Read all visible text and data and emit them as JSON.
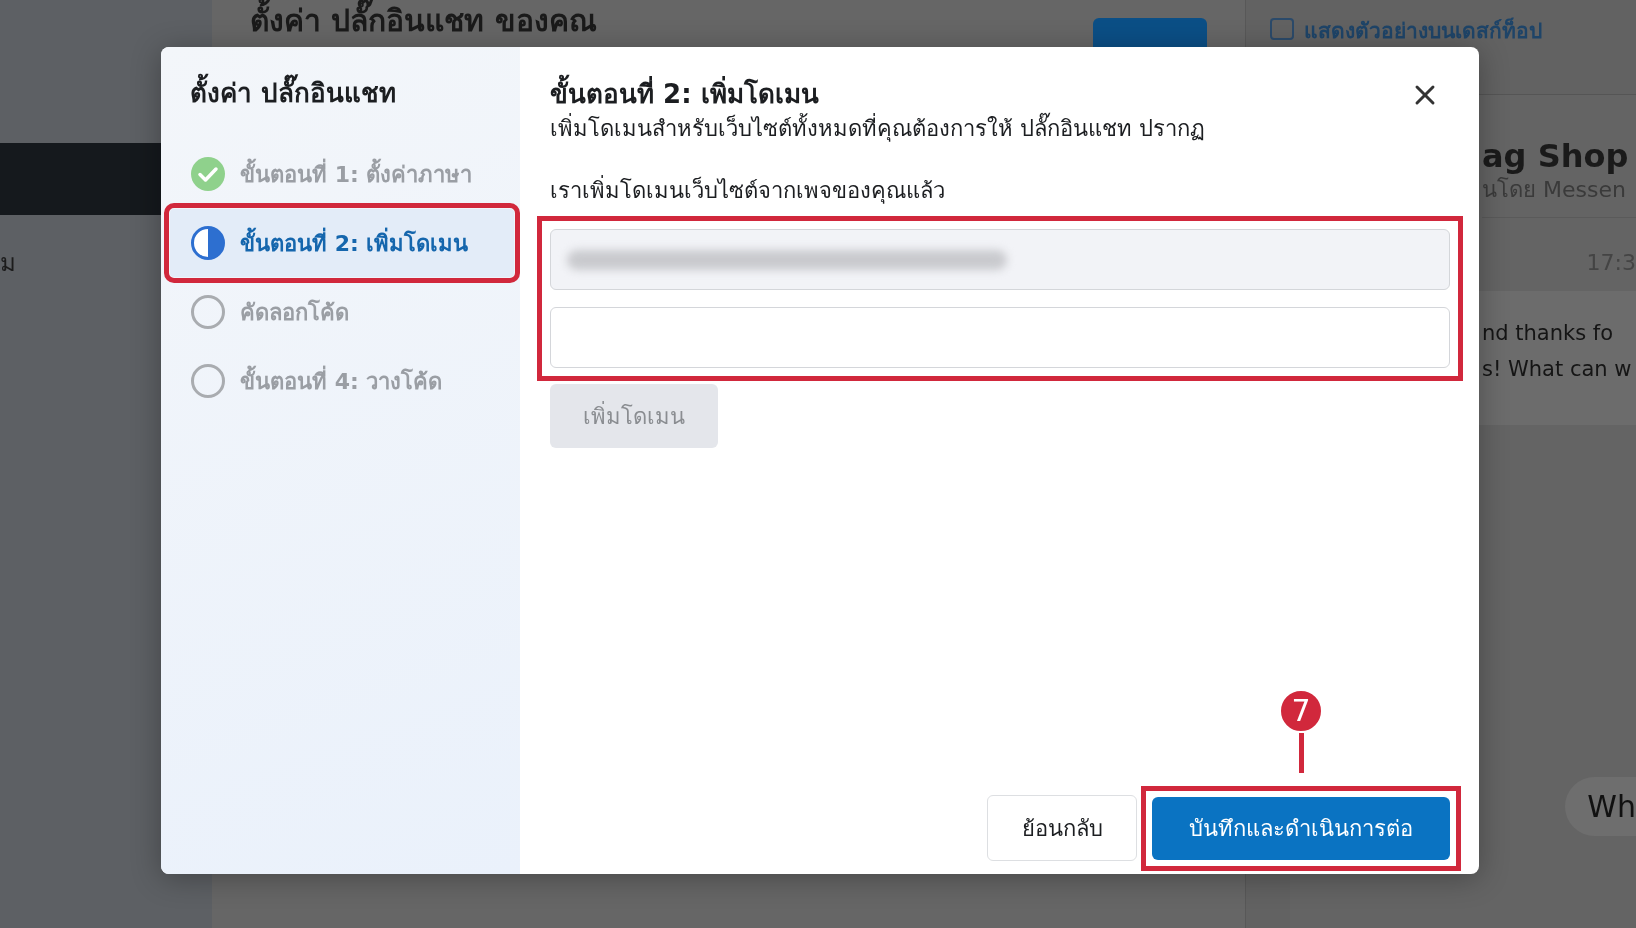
{
  "background": {
    "page_title": "ตั้งค่า ปลั๊กอินแชท ของคณ",
    "sidebar_text": "ม",
    "preview_checkbox": {
      "label": "แสดงตัวอย่างบนเดสก์ท็อป",
      "checked": false
    },
    "preview": {
      "shop_name": "ag Shop",
      "subtitle": "นโดย Messen",
      "time": "17:3",
      "message_lines": [
        "nd thanks fo",
        "s! What can w"
      ],
      "reply": "Wh"
    }
  },
  "dialog": {
    "sidebar_title": "ตั้งค่า ปลั๊กอินแชท",
    "steps": [
      {
        "label": "ขั้นตอนที่ 1: ตั้งค่าภาษา",
        "kind": "done",
        "selected": false,
        "highlighted": false
      },
      {
        "label": "ขั้นตอนที่ 2: เพิ่มโดเมน",
        "kind": "current",
        "selected": true,
        "highlighted": true
      },
      {
        "label": "คัดลอกโค้ด",
        "kind": "pending",
        "selected": false,
        "highlighted": false
      },
      {
        "label": "ขั้นตอนที่ 4: วางโค้ด",
        "kind": "pending",
        "selected": false,
        "highlighted": false
      }
    ],
    "title": "ขั้นตอนที่ 2: เพิ่มโดเมน",
    "description": "เพิ่มโดเมนสำหรับเว็บไซต์ทั้งหมดที่คุณต้องการให้ ปลั๊กอินแชท ปรากฏ",
    "domains_label": "เราเพิ่มโดเมนเว็บไซต์จากเพจของคุณแล้ว",
    "domains_highlighted": true,
    "domain_fields": [
      {
        "kind": "redacted"
      },
      {
        "kind": "empty"
      }
    ],
    "add_button": {
      "label": "เพิ่มโดเมน",
      "disabled": true
    },
    "back_button": {
      "label": "ย้อนกลับ"
    },
    "save_button": {
      "label": "บันทึกและดำเนินการต่อ",
      "highlighted": true,
      "callout": "7"
    }
  }
}
